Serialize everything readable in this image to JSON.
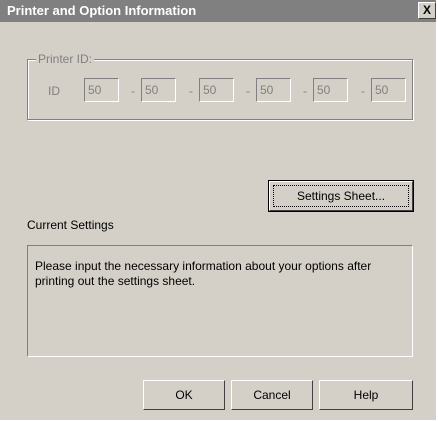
{
  "window": {
    "title": "Printer and Option Information",
    "close_label": "X"
  },
  "printer_id": {
    "group_label": "Printer ID:",
    "id_label": "ID",
    "fields": [
      "50",
      "50",
      "50",
      "50",
      "50",
      "50"
    ],
    "separator": "-"
  },
  "settings_sheet_button": "Settings Sheet...",
  "current_settings": {
    "label": "Current Settings",
    "text": "Please input the necessary information about your options after printing out the settings sheet."
  },
  "buttons": {
    "ok": "OK",
    "cancel": "Cancel",
    "help": "Help"
  }
}
